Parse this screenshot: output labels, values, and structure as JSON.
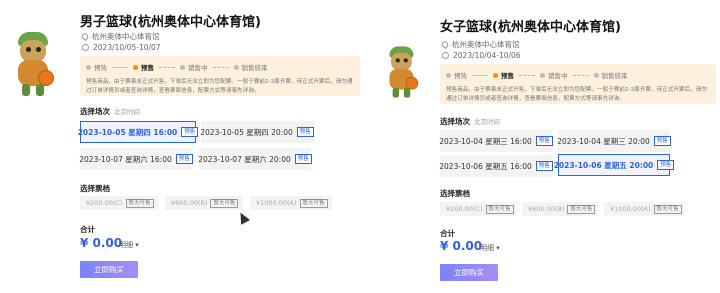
{
  "panel1": {
    "title": "男子篮球(杭州奥体中心体育馆)",
    "venue": "杭州奥体中心体育馆",
    "date_range": "2023/10/05-10/07",
    "steps": [
      "预热",
      "预售",
      "销售中",
      "销售结束"
    ],
    "active_step": 1,
    "notice": "预售商品，由于赛事未正式开售，下单后无法立即为您配票。一般于赛前2-3周开票，待正式开票后，请勿通过订单详情页或者查询详情，查看票面信息，配票方式等请事先详询。",
    "session_label": "选择场次",
    "session_hint": "北京时间",
    "sessions": [
      {
        "text": "2023-10-05 星期四 16:00",
        "tag": "预售",
        "selected": true
      },
      {
        "text": "2023-10-05 星期四 20:00",
        "tag": "预售",
        "selected": false
      },
      {
        "text": "2023-10-07 星期六 16:00",
        "tag": "预售",
        "selected": false
      },
      {
        "text": "2023-10-07 星期六 20:00",
        "tag": "预售",
        "selected": false
      }
    ],
    "price_label": "选择票档",
    "prices": [
      {
        "text": "¥200.00(C)",
        "tag": "暂无可售"
      },
      {
        "text": "¥600.00(B)",
        "tag": "暂无可售"
      },
      {
        "text": "¥1000.00(A)",
        "tag": "暂无可售"
      }
    ],
    "total_label": "合计",
    "total": "¥ 0.00",
    "detail": "明细 ▾",
    "buy": "立即购买"
  },
  "panel2": {
    "title": "女子篮球(杭州奥体中心体育馆)",
    "venue": "杭州奥体中心体育馆",
    "date_range": "2023/10/04-10/06",
    "steps": [
      "预热",
      "预售",
      "销售中",
      "销售结束"
    ],
    "active_step": 1,
    "notice": "预售商品，由于赛事未正式开售，下单后无法立即为您配票。一般于赛前2-3周开票，待正式开票后，请勿通过订单详情页或者查询详情，查看票面信息，配票方式等请事先详询。",
    "session_label": "选择场次",
    "session_hint": "北京时间",
    "sessions": [
      {
        "text": "2023-10-04 星期三 16:00",
        "tag": "预售",
        "selected": false
      },
      {
        "text": "2023-10-04 星期三 20:00",
        "tag": "预售",
        "selected": false
      },
      {
        "text": "2023-10-06 星期五 16:00",
        "tag": "预售",
        "selected": false
      },
      {
        "text": "2023-10-06 星期五 20:00",
        "tag": "预售",
        "selected": true
      }
    ],
    "price_label": "选择票档",
    "prices": [
      {
        "text": "¥200.00(C)",
        "tag": "暂无可售"
      },
      {
        "text": "¥600.00(B)",
        "tag": "暂无可售"
      },
      {
        "text": "¥1000.00(A)",
        "tag": "暂无可售"
      }
    ],
    "total_label": "合计",
    "total": "¥ 0.00",
    "detail": "明细 ▾",
    "buy": "立即购买"
  }
}
